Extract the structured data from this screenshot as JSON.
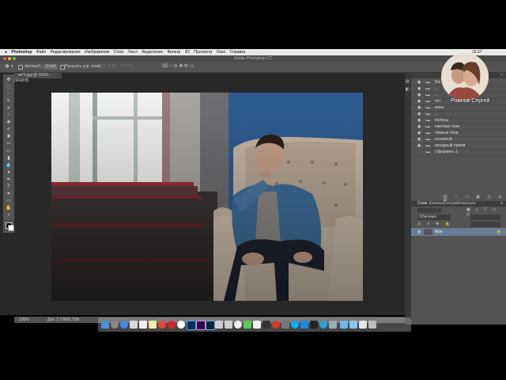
{
  "menubar": {
    "apple": "",
    "items": [
      "Photoshop",
      "Файл",
      "Редактирование",
      "Изображение",
      "Слои",
      "Текст",
      "Выделение",
      "Фильтр",
      "3D",
      "Просмотр",
      "Окно",
      "Справка"
    ],
    "clock": "15:27"
  },
  "window": {
    "title": "Adobe Photoshop CC"
  },
  "options": {
    "autoselect_label": "Автовыб.:",
    "autoselect_value": "Слой",
    "show_controls": "Показать упр. элем."
  },
  "document": {
    "tab_title": "ки*1.jpg @ 100% (RGB/8)"
  },
  "status": {
    "zoom": "100%",
    "doc_info": "Док: 2,70М/5,75М"
  },
  "layers_panel": {
    "rows": [
      {
        "name": "Dis"
      },
      {
        "name": "..."
      },
      {
        "name": "..."
      },
      {
        "name": "тёт"
      },
      {
        "name": "кожа"
      },
      {
        "name": "..."
      },
      {
        "name": "волосы"
      },
      {
        "name": "светлые тени"
      },
      {
        "name": "тёмные тени"
      },
      {
        "name": "основной"
      },
      {
        "name": "исходный прием"
      },
      {
        "name": "Оформить 2"
      }
    ],
    "tabs": [
      "Слои",
      "Каналы",
      "Контуры",
      "Операции"
    ],
    "blend_mode": "Обычные",
    "background_layer": "Фон"
  },
  "watermark": {
    "author": "Рожнов Сергей"
  },
  "colors": {
    "workspace": "#282828",
    "panel": "#535353",
    "menubar": "#e9e9e9",
    "wall_blue": "#2f5d93"
  }
}
